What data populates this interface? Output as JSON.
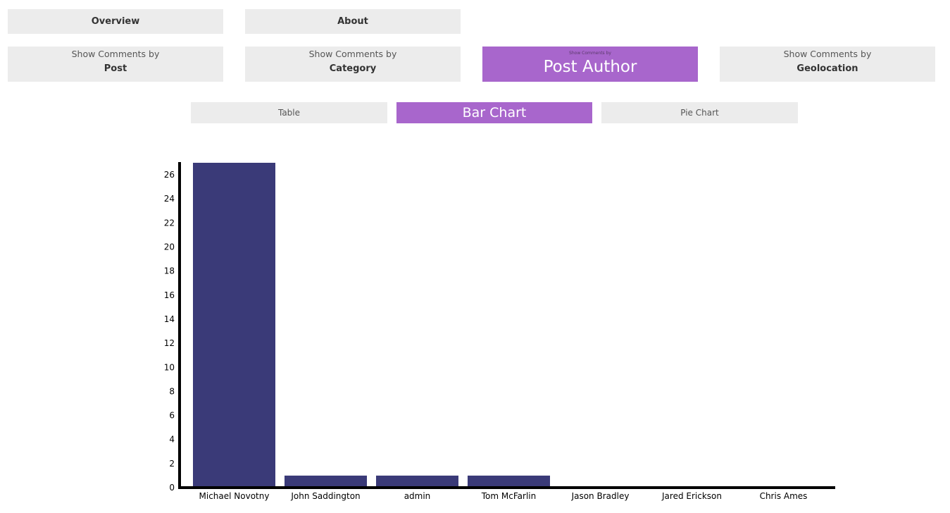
{
  "nav": {
    "overview_label": "Overview",
    "about_label": "About"
  },
  "groupings": [
    {
      "prefix": "Show Comments by",
      "label": "Post",
      "active": false
    },
    {
      "prefix": "Show Comments by",
      "label": "Category",
      "active": false
    },
    {
      "prefix": "Show Comments by",
      "label": "Post Author",
      "active": true
    },
    {
      "prefix": "Show Comments by",
      "label": "Geolocation",
      "active": false
    }
  ],
  "views": {
    "table_label": "Table",
    "bar_chart_label": "Bar Chart",
    "pie_chart_label": "Pie Chart",
    "active": "Bar Chart"
  },
  "colors": {
    "accent": "#a866cc",
    "button_bg": "#ececec",
    "bar_fill": "#3a3a78",
    "axis": "#000000"
  },
  "chart_data": {
    "type": "bar",
    "categories": [
      "Michael Novotny",
      "John Saddington",
      "admin",
      "Tom McFarlin",
      "Jason Bradley",
      "Jared Erickson",
      "Chris Ames"
    ],
    "values": [
      27,
      1,
      1,
      1,
      0,
      0,
      0
    ],
    "yticks": [
      0,
      2,
      4,
      6,
      8,
      10,
      12,
      14,
      16,
      18,
      20,
      22,
      24,
      26
    ],
    "ylim": [
      0,
      27
    ],
    "title": "",
    "xlabel": "",
    "ylabel": "",
    "grid": false
  }
}
